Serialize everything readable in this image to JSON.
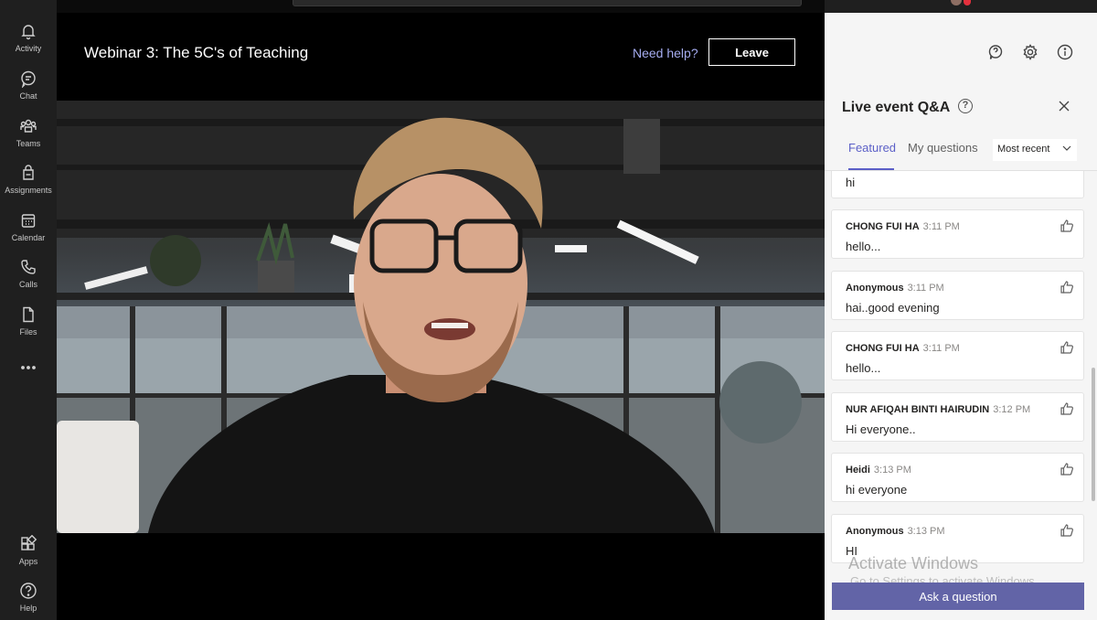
{
  "rail": {
    "items": [
      {
        "label": "Activity",
        "icon": "bell-icon"
      },
      {
        "label": "Chat",
        "icon": "chat-icon"
      },
      {
        "label": "Teams",
        "icon": "teams-icon"
      },
      {
        "label": "Assignments",
        "icon": "assignments-icon"
      },
      {
        "label": "Calendar",
        "icon": "calendar-icon"
      },
      {
        "label": "Calls",
        "icon": "phone-icon"
      },
      {
        "label": "Files",
        "icon": "file-icon"
      },
      {
        "label": "",
        "icon": "more-icon"
      }
    ],
    "bottom_items": [
      {
        "label": "Apps",
        "icon": "apps-icon"
      },
      {
        "label": "Help",
        "icon": "help-icon"
      }
    ]
  },
  "stage": {
    "title": "Webinar 3: The 5C's of Teaching",
    "need_help": "Need help?",
    "leave_label": "Leave"
  },
  "panel": {
    "title": "Live event Q&A",
    "tabs": {
      "featured": "Featured",
      "my_questions": "My questions"
    },
    "sort_value": "Most recent",
    "questions": [
      {
        "author": "",
        "time": "",
        "message": "hi"
      },
      {
        "author": "CHONG FUI HA",
        "time": "3:11 PM",
        "message": "hello..."
      },
      {
        "author": "Anonymous",
        "time": "3:11 PM",
        "message": "hai..good evening"
      },
      {
        "author": "CHONG FUI HA",
        "time": "3:11 PM",
        "message": "hello..."
      },
      {
        "author": "NUR AFIQAH BINTI HAIRUDIN",
        "time": "3:12 PM",
        "message": "Hi everyone.."
      },
      {
        "author": "Heidi",
        "time": "3:13 PM",
        "message": "hi everyone"
      },
      {
        "author": "Anonymous",
        "time": "3:13 PM",
        "message": "HI"
      }
    ],
    "ask_label": "Ask a question"
  },
  "watermark": {
    "line1": "Activate Windows",
    "line2": "Go to Settings to activate Windows."
  },
  "colors": {
    "accent": "#6264a7",
    "tab_active": "#5b5fc7",
    "rail_bg": "#1f1f1f"
  }
}
